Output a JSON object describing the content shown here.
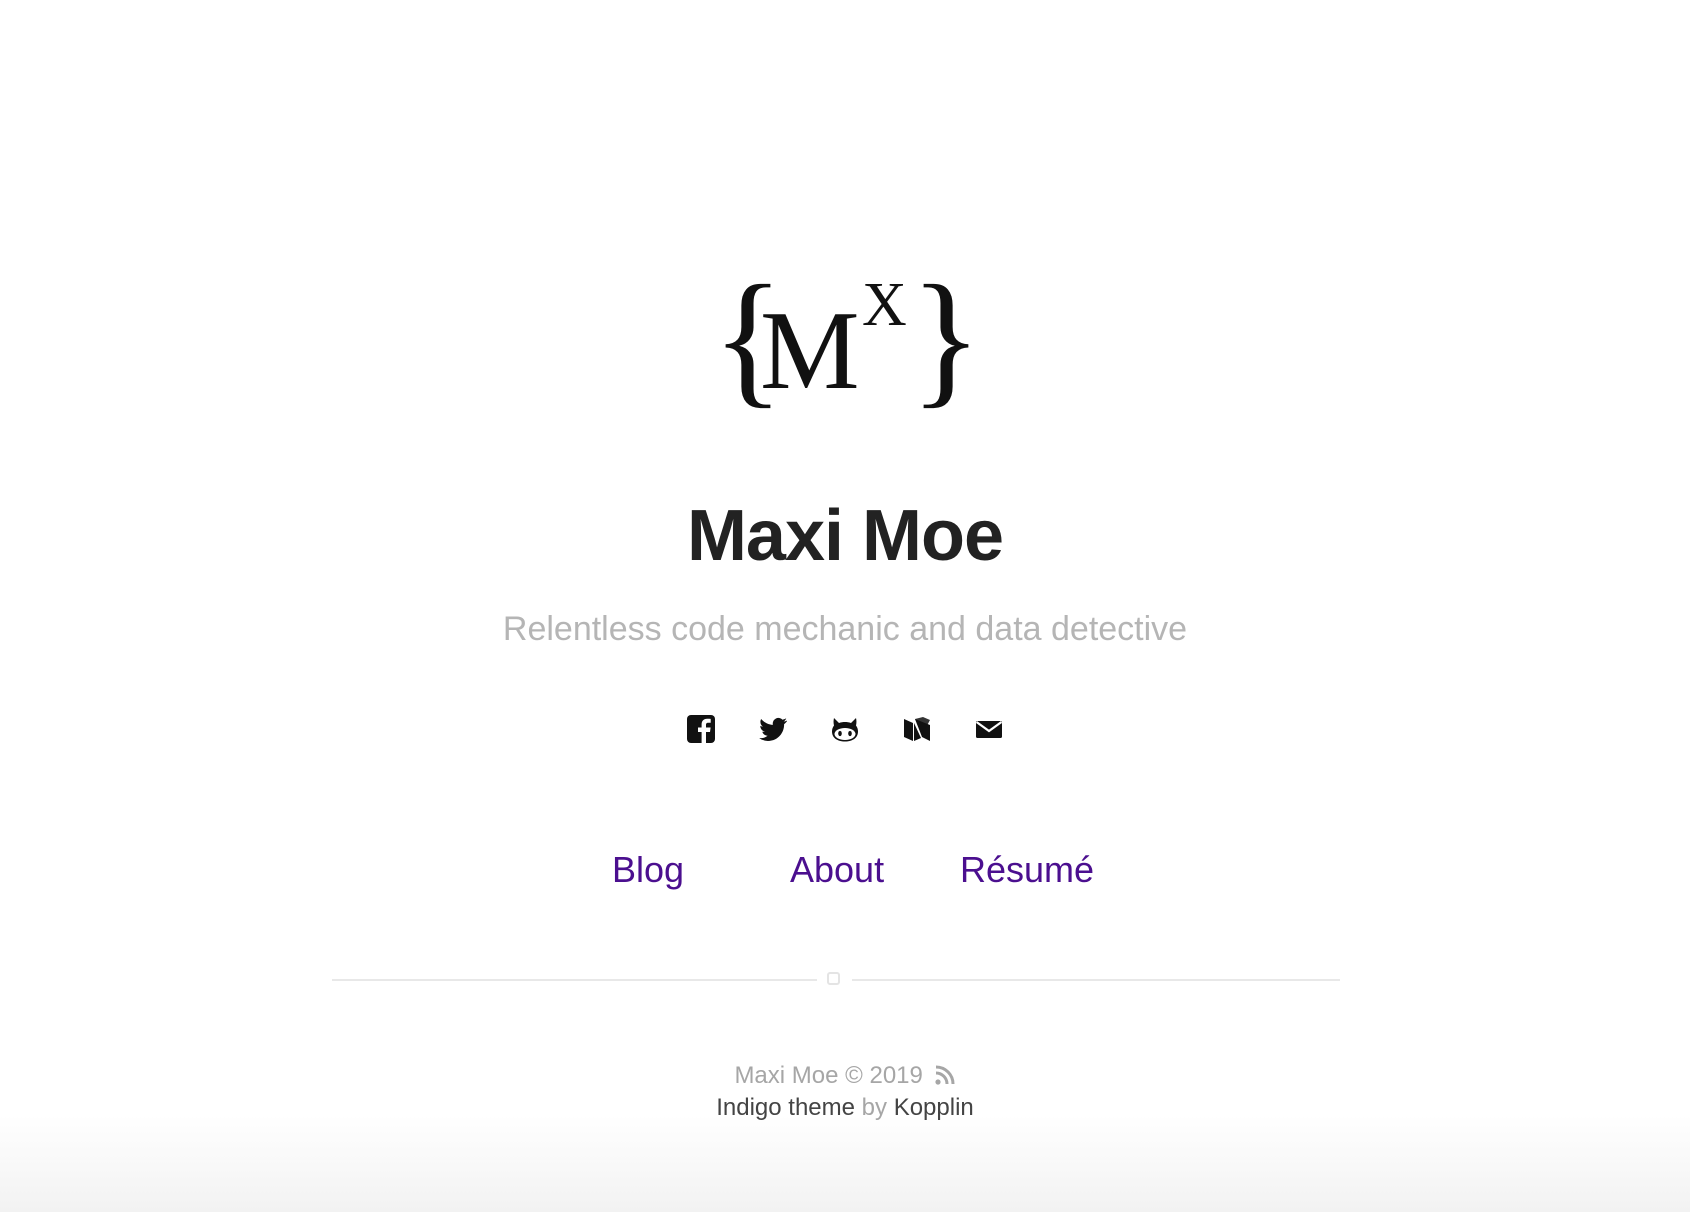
{
  "logo": {
    "text_main": "M",
    "text_super": "X",
    "brace_left": "{",
    "brace_right": "}"
  },
  "site": {
    "title": "Maxi Moe",
    "tagline": "Relentless code mechanic and data detective"
  },
  "social": [
    {
      "name": "facebook-icon"
    },
    {
      "name": "twitter-icon"
    },
    {
      "name": "github-icon"
    },
    {
      "name": "medium-icon"
    },
    {
      "name": "mail-icon"
    }
  ],
  "nav": {
    "blog": "Blog",
    "about": "About",
    "resume": "Résumé"
  },
  "footer": {
    "copyright": "Maxi Moe © 2019",
    "theme": "Indigo theme",
    "by": "by",
    "author": "Kopplin"
  },
  "colors": {
    "link": "#4b0f8f",
    "title": "#222222",
    "muted": "#b5b5b5"
  }
}
